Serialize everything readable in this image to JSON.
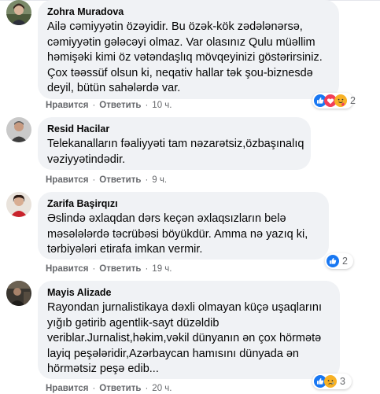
{
  "ui": {
    "like_label": "Нравится",
    "reply_label": "Ответить",
    "separator": "·"
  },
  "comments": [
    {
      "author": "Zohra Muradova",
      "avatar_icon": "profile-photo-woman-icon",
      "lines": [
        "Ailə cəmiyyətin özəyidir. Bu özək-kök zədələnərsə,",
        "cəmiyyətin gələcəyi olmaz. Var olasınız Qulu müəllim",
        "həmişəki kimi öz vətəndaşlıq mövqeyinizi göstərirsiniz.",
        "Çox təəssüf olsun ki, neqativ hallar tək şou-biznesdə",
        "deyil, bütün sahələrdə var."
      ],
      "time": "10 ч.",
      "reactions": {
        "icons": [
          "like-icon",
          "love-icon",
          "care-icon"
        ],
        "count": "2"
      }
    },
    {
      "author": "Resid Hacilar",
      "avatar_icon": "profile-photo-man-icon",
      "lines": [
        "Telekanalların fəaliyyəti tam nəzarətsiz,özbaşınalıq",
        "vəziyyətindədir."
      ],
      "time": "9 ч.",
      "reactions": null
    },
    {
      "author": "Zarifa Başirqızı",
      "avatar_icon": "profile-photo-woman-red-icon",
      "lines": [
        "Əslində əxlaqdan dərs keçən əxlaqsızların belə",
        "məsələlərdə təcrübəsi böyükdür. Amma nə yazıq ki,",
        "tərbiyələri etirafa imkan vermir."
      ],
      "time": "19 ч.",
      "reactions": {
        "icons": [
          "like-icon"
        ],
        "count": "2"
      }
    },
    {
      "author": "Mayis Alizade",
      "avatar_icon": "profile-photo-man-dark-icon",
      "lines": [
        "Rayondan jurnalistikaya dəxli olmayan küçə uşaqlarını",
        "yığıb gətirib agentlik-sayt düzəldib",
        "veriblar.Jurnalist,həkim,vəkil dünyanın ən çox hörmətə",
        "layiq peşələridir,Azərbaycan hamısını dünyada ən",
        "hörmətsiz peşə edib..."
      ],
      "time": "20 ч.",
      "reactions": {
        "icons": [
          "like-icon",
          "sad-icon"
        ],
        "count": "3"
      }
    }
  ]
}
